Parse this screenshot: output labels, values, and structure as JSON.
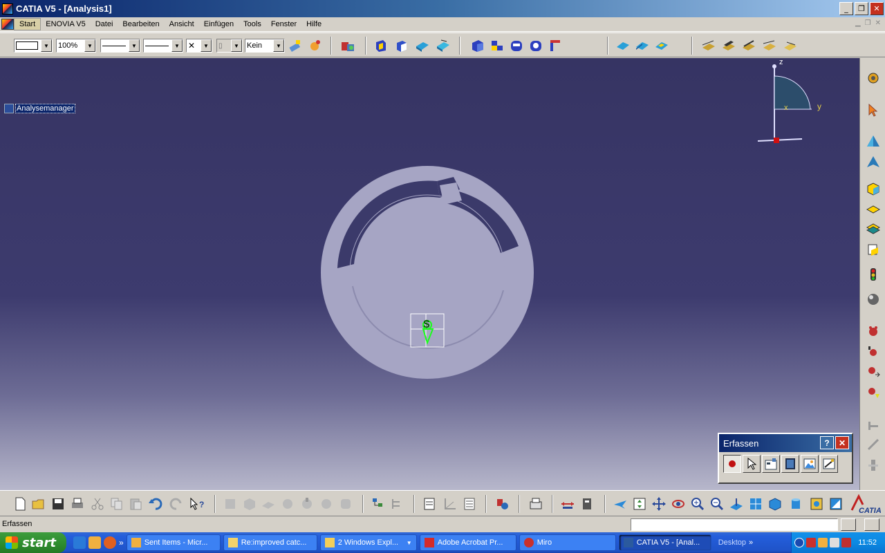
{
  "window": {
    "title": "CATIA V5 - [Analysis1]"
  },
  "menubar": {
    "items": [
      "Start",
      "ENOVIA V5",
      "Datei",
      "Bearbeiten",
      "Ansicht",
      "Einfügen",
      "Tools",
      "Fenster",
      "Hilfe"
    ]
  },
  "toolbar_top": {
    "zoom_value": "100%",
    "layer_value": "Kein"
  },
  "tree": {
    "root_label": "Analysemanager"
  },
  "compass": {
    "z_label": "z",
    "y_label": "y",
    "x_label": "x"
  },
  "erfassen_palette": {
    "title": "Erfassen",
    "help_label": "?",
    "close_label": "✕"
  },
  "statusbar": {
    "text": "Erfassen"
  },
  "taskbar": {
    "start_label": "start",
    "tasks": [
      {
        "label": "Sent Items - Micr...",
        "icon": "outlook-icon",
        "color": "#f0b040"
      },
      {
        "label": "Re:improved catc...",
        "icon": "mail-icon",
        "color": "#f2d36b"
      },
      {
        "label": "2 Windows Expl...",
        "icon": "folder-icon",
        "color": "#f3cf5a"
      },
      {
        "label": "Adobe Acrobat Pr...",
        "icon": "acrobat-icon",
        "color": "#d42a2a"
      },
      {
        "label": "Miro",
        "icon": "miro-icon",
        "color": "#c9302c"
      },
      {
        "label": "CATIA V5 - [Anal...",
        "icon": "catia-icon",
        "color": "#2b5a9e"
      }
    ],
    "desktop_label": "Desktop",
    "overflow": "»",
    "clock": "11:52"
  },
  "colors": {
    "viewport_top": "#363463",
    "part_fill": "#a6a5c4",
    "titlebar": "#0a246a"
  }
}
